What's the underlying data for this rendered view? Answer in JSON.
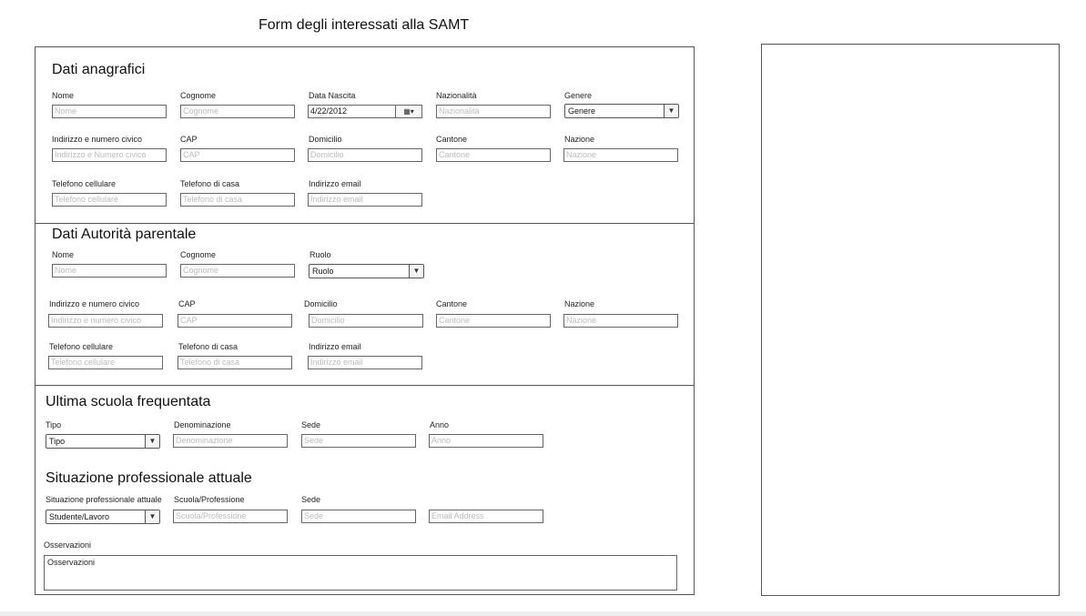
{
  "page": {
    "title": "Form degli interessati alla SAMT"
  },
  "anagrafici": {
    "title": "Dati anagrafici",
    "nome": {
      "label": "Nome",
      "placeholder": "Nome"
    },
    "cognome": {
      "label": "Cognome",
      "placeholder": "Cognome"
    },
    "data_nascita": {
      "label": "Data Nascita",
      "value": "4/22/2012"
    },
    "nazionalita": {
      "label": "Nazionalità",
      "placeholder": "Nazionalità"
    },
    "genere": {
      "label": "Genere",
      "value": "Genere"
    },
    "indirizzo": {
      "label": "Indirizzo e numero civico",
      "placeholder": "Indirizzo e Numero civico"
    },
    "cap": {
      "label": "CAP",
      "placeholder": "CAP"
    },
    "domicilio": {
      "label": "Domicilio",
      "placeholder": "Domicilio"
    },
    "cantone": {
      "label": "Cantone",
      "placeholder": "Cantone"
    },
    "nazione": {
      "label": "Nazione",
      "placeholder": "Nazione"
    },
    "tel_cell": {
      "label": "Telefono cellulare",
      "placeholder": "Telefono cellulare"
    },
    "tel_casa": {
      "label": "Telefono di casa",
      "placeholder": "Telefono di casa"
    },
    "email": {
      "label": "Indirizzo email",
      "placeholder": "Indirizzo email"
    }
  },
  "parentale": {
    "title": "Dati Autorità parentale",
    "nome": {
      "label": "Nome",
      "placeholder": "Nome"
    },
    "cognome": {
      "label": "Cognome",
      "placeholder": "Cognome"
    },
    "ruolo": {
      "label": "Ruolo",
      "value": "Ruolo"
    },
    "indirizzo": {
      "label": "Indirizzo e numero civico",
      "placeholder": "Indirizzo e numero civico"
    },
    "cap": {
      "label": "CAP",
      "placeholder": "CAP"
    },
    "domicilio": {
      "label": "Domicilio",
      "placeholder": "Domicilio"
    },
    "cantone": {
      "label": "Cantone",
      "placeholder": "Cantone"
    },
    "nazione": {
      "label": "Nazione",
      "placeholder": "Nazione"
    },
    "tel_cell": {
      "label": "Telefono cellulare",
      "placeholder": "Telefono cellulare"
    },
    "tel_casa": {
      "label": "Telefono di casa",
      "placeholder": "Telefono di casa"
    },
    "email": {
      "label": "Indirizzo email",
      "placeholder": "Indirizzo email"
    }
  },
  "scuola": {
    "title": "Ultima scuola frequentata",
    "tipo": {
      "label": "Tipo",
      "value": "Tipo"
    },
    "denominazione": {
      "label": "Denominazione",
      "placeholder": "Denominazione"
    },
    "sede": {
      "label": "Sede",
      "placeholder": "Sede"
    },
    "anno": {
      "label": "Anno",
      "placeholder": "Anno"
    }
  },
  "professione": {
    "title": "Situazione professionale attuale",
    "situazione": {
      "label": "Situazione professionale attuale",
      "value": "Studente/Lavoro"
    },
    "scuola_prof": {
      "label": "Scuola/Professione",
      "placeholder": "Scuola/Professione"
    },
    "sede": {
      "label": "Sede",
      "placeholder": "Sede"
    },
    "email": {
      "placeholder": "Email Address"
    }
  },
  "osservazioni": {
    "label": "Osservazioni",
    "placeholder": "Osservazioni"
  },
  "icons": {
    "dropdown": "chevron-down-icon",
    "calendar": "calendar-icon"
  }
}
